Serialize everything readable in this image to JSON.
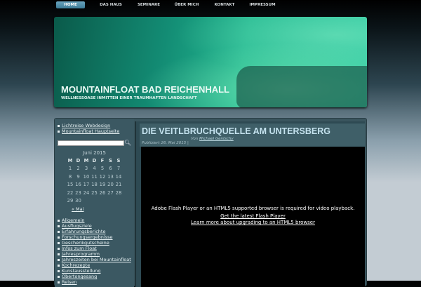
{
  "nav": [
    "Home",
    "Das Haus",
    "Seminare",
    "Über mich",
    "Kontakt",
    "Impressum"
  ],
  "header": {
    "title": "MOUNTAINFLOAT BAD REICHENHALL",
    "tagline": "WELLNESSOASE INMITTEN EINER TRAUMHAFTEN LANDSCHAFT"
  },
  "sidebar": {
    "links": [
      "Lichtreise Webdesign",
      "Mountainfloat Hauptseite"
    ],
    "search_value": "",
    "calendar": {
      "caption": "Juni 2015",
      "days": [
        "M",
        "D",
        "M",
        "D",
        "F",
        "S",
        "S"
      ],
      "weeks": [
        [
          "1",
          "2",
          "3",
          "4",
          "5",
          "6",
          "7"
        ],
        [
          "8",
          "9",
          "10",
          "11",
          "12",
          "13",
          "14"
        ],
        [
          "15",
          "16",
          "17",
          "18",
          "19",
          "20",
          "21"
        ],
        [
          "22",
          "23",
          "24",
          "25",
          "26",
          "27",
          "28"
        ],
        [
          "29",
          "30",
          "",
          "",
          "",
          "",
          ""
        ]
      ],
      "prev": "« Mai"
    },
    "categories": [
      "Allgemein",
      "Ausflugsziele",
      "Erfahrungsberichte",
      "Forschungsergebnisse",
      "Geschenkgutscheine",
      "Infos zum Float",
      "Jahresprogramm",
      "Jahreszeiten bei Mountainfloat",
      "Kochrezepte",
      "Kunstausstellung",
      "Obertongesang",
      "Reisen"
    ]
  },
  "post": {
    "title": "DIE VEITLBRUCHQUELLE AM UNTERSBERG",
    "by": "Von",
    "author": "Michael Gentschy",
    "date": "Publiziert 26. Mai 2015 |",
    "video": {
      "message": "Adobe Flash Player or an HTML5 supported browser is required for video playback.",
      "link1": "Get the latest Flash Player",
      "link2": "Learn more about upgrading to an HTML5 browser"
    }
  }
}
